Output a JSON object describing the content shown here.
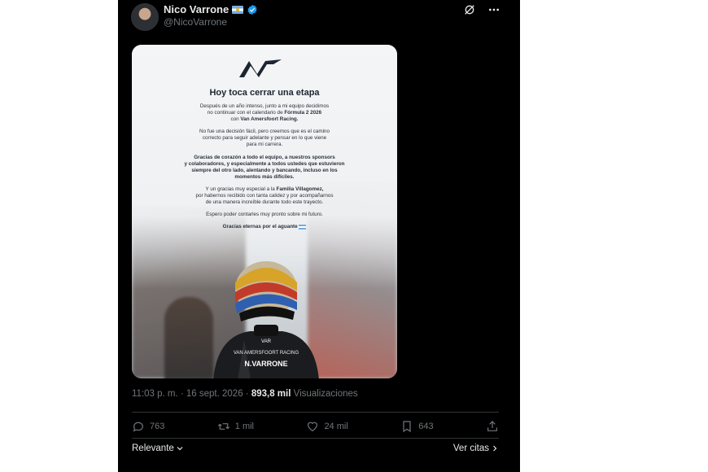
{
  "post": {
    "author_name": "Nico Varrone",
    "author_handle": "@NicoVarrone",
    "timestamp": "11:03 p. m. · 16 sept. 2026 · ",
    "views_count": "893,8 mil",
    "views_label": " Visualizaciones"
  },
  "media": {
    "title": "Hoy toca cerrar una etapa",
    "p1_a": "Después de un año intenso, junto a mi equipo decidimos",
    "p1_b": "no continuar con el calendario de ",
    "p1_b_bold": "Fórmula 2 2026",
    "p1_c": "con ",
    "p1_c_bold": "Van Amersfoort Racing.",
    "p2_a": "No fue una decisión fácil, pero creemos que es el camino",
    "p2_b": "correcto para seguir adelante y pensar en lo que viene",
    "p2_c": "para mi carrera.",
    "p3_a": "Gracias de corazón a todo el equipo, a nuestros sponsors",
    "p3_b": "y colaboradores, y especialmente a todos ustedes que estuvieron",
    "p3_c": "siempre del otro lado, alentando y bancando, incluso en los",
    "p3_d": "momentos más difíciles.",
    "p4_a": "Y un gracias muy especial a la ",
    "p4_a_bold": "Familia Villagomez,",
    "p4_b": "por habernos recibido con tanta calidez y por acompañarnos",
    "p4_c": "de una manera increíble durante todo este trayecto.",
    "p5": "Espero poder contarles muy pronto sobre mi futuro.",
    "p6": "Gracias eternas por el aguante",
    "suit_team": "VAN AMERSFOORT RACING",
    "suit_name": "N.VARRONE",
    "suit_logo": "VAR"
  },
  "actions": {
    "replies": "763",
    "reposts": "1 mil",
    "likes": "24 mil",
    "bookmarks": "643"
  },
  "footer": {
    "sort_label": "Relevante",
    "quotes_label": "Ver citas"
  },
  "icons": [
    "verified-icon",
    "flag-icon",
    "grok-icon",
    "more-icon",
    "reply-icon",
    "repost-icon",
    "like-icon",
    "bookmark-icon",
    "share-icon"
  ],
  "colors": {
    "verified": "#1d9bf0",
    "background": "#000000",
    "muted": "#71767b"
  }
}
